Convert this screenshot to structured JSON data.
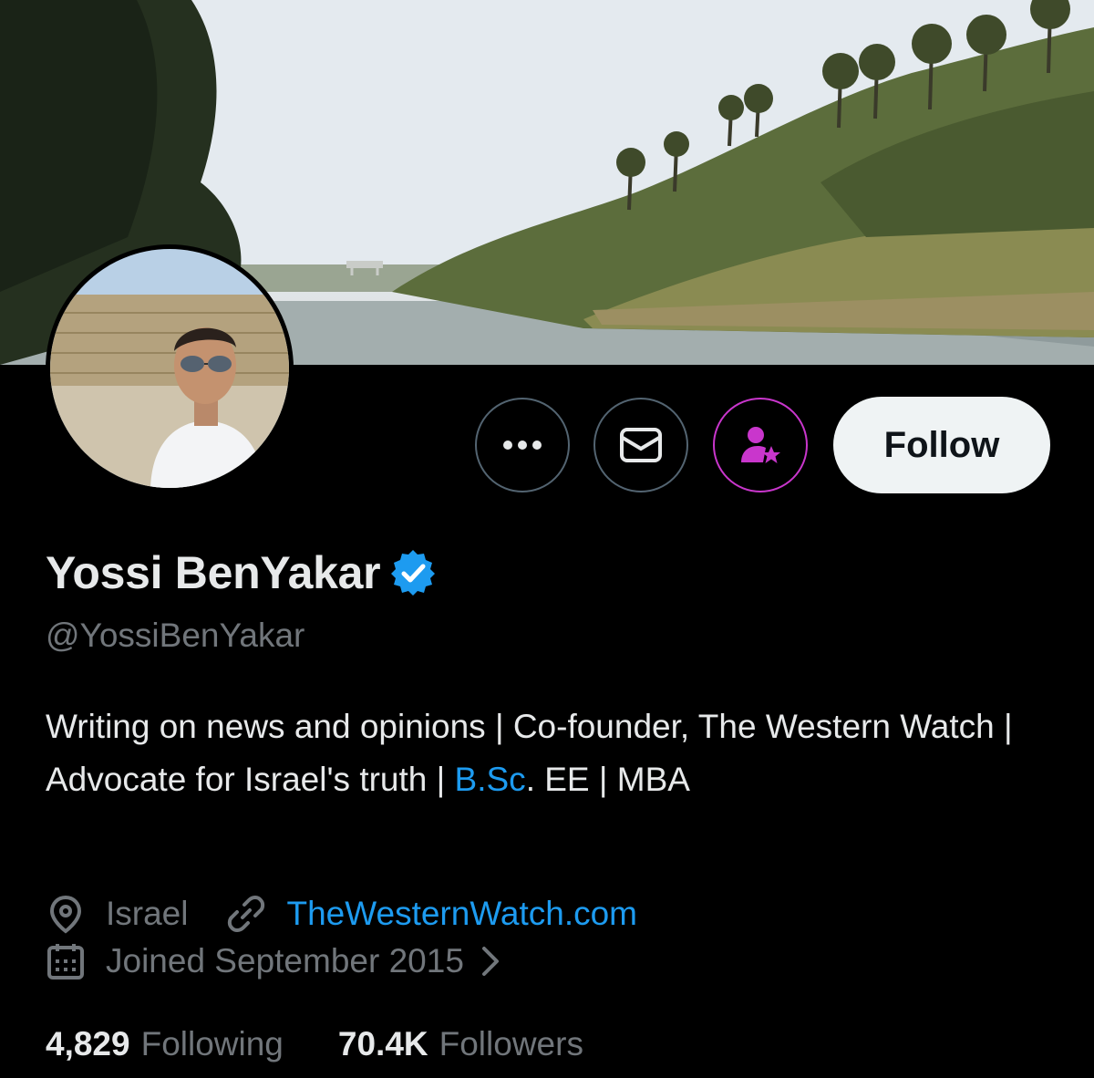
{
  "banner": {
    "description_icon": "banner-image"
  },
  "avatar": {
    "icon": "profile-photo"
  },
  "actions": {
    "more_icon": "more-dots-icon",
    "message_icon": "envelope-icon",
    "subscribe_icon": "subscribe-icon",
    "follow_label": "Follow"
  },
  "profile": {
    "name": "Yossi BenYakar",
    "handle": "@YossiBenYakar",
    "bio_parts": {
      "before_link": "Writing on news and opinions | Co-founder, The Western Watch | Advocate for Israel's truth | ",
      "link": "B.Sc",
      "after_link": ". EE | MBA"
    },
    "location": "Israel",
    "website": "TheWesternWatch.com",
    "joined": "Joined September 2015",
    "following_count": "4,829",
    "following_label": "Following",
    "followers_count": "70.4K",
    "followers_label": "Followers"
  },
  "colors": {
    "background": "#000000",
    "accent_blue": "#1d9bf0",
    "subscribe_purple": "#c936cc",
    "muted_text": "#71767b",
    "primary_text": "#e7e9ea"
  }
}
